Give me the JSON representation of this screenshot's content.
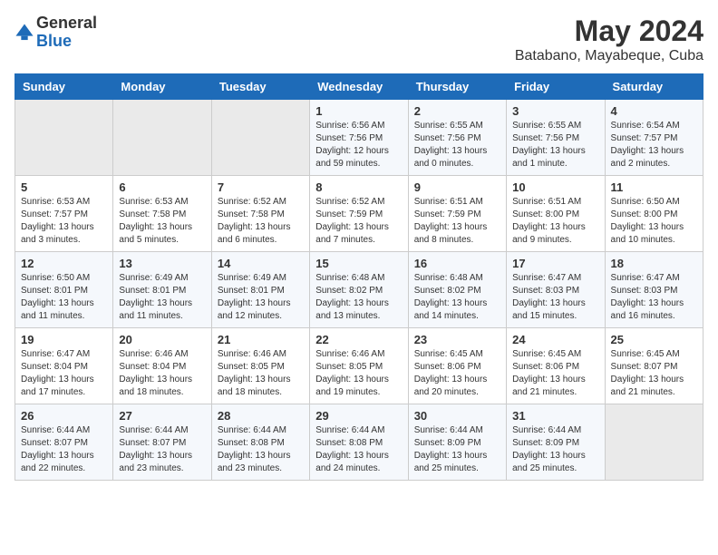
{
  "logo": {
    "general": "General",
    "blue": "Blue"
  },
  "title": "May 2024",
  "subtitle": "Batabano, Mayabeque, Cuba",
  "weekdays": [
    "Sunday",
    "Monday",
    "Tuesday",
    "Wednesday",
    "Thursday",
    "Friday",
    "Saturday"
  ],
  "weeks": [
    [
      {
        "day": "",
        "sunrise": "",
        "sunset": "",
        "daylight": "",
        "empty": true
      },
      {
        "day": "",
        "sunrise": "",
        "sunset": "",
        "daylight": "",
        "empty": true
      },
      {
        "day": "",
        "sunrise": "",
        "sunset": "",
        "daylight": "",
        "empty": true
      },
      {
        "day": "1",
        "sunrise": "Sunrise: 6:56 AM",
        "sunset": "Sunset: 7:56 PM",
        "daylight": "Daylight: 12 hours and 59 minutes."
      },
      {
        "day": "2",
        "sunrise": "Sunrise: 6:55 AM",
        "sunset": "Sunset: 7:56 PM",
        "daylight": "Daylight: 13 hours and 0 minutes."
      },
      {
        "day": "3",
        "sunrise": "Sunrise: 6:55 AM",
        "sunset": "Sunset: 7:56 PM",
        "daylight": "Daylight: 13 hours and 1 minute."
      },
      {
        "day": "4",
        "sunrise": "Sunrise: 6:54 AM",
        "sunset": "Sunset: 7:57 PM",
        "daylight": "Daylight: 13 hours and 2 minutes."
      }
    ],
    [
      {
        "day": "5",
        "sunrise": "Sunrise: 6:53 AM",
        "sunset": "Sunset: 7:57 PM",
        "daylight": "Daylight: 13 hours and 3 minutes."
      },
      {
        "day": "6",
        "sunrise": "Sunrise: 6:53 AM",
        "sunset": "Sunset: 7:58 PM",
        "daylight": "Daylight: 13 hours and 5 minutes."
      },
      {
        "day": "7",
        "sunrise": "Sunrise: 6:52 AM",
        "sunset": "Sunset: 7:58 PM",
        "daylight": "Daylight: 13 hours and 6 minutes."
      },
      {
        "day": "8",
        "sunrise": "Sunrise: 6:52 AM",
        "sunset": "Sunset: 7:59 PM",
        "daylight": "Daylight: 13 hours and 7 minutes."
      },
      {
        "day": "9",
        "sunrise": "Sunrise: 6:51 AM",
        "sunset": "Sunset: 7:59 PM",
        "daylight": "Daylight: 13 hours and 8 minutes."
      },
      {
        "day": "10",
        "sunrise": "Sunrise: 6:51 AM",
        "sunset": "Sunset: 8:00 PM",
        "daylight": "Daylight: 13 hours and 9 minutes."
      },
      {
        "day": "11",
        "sunrise": "Sunrise: 6:50 AM",
        "sunset": "Sunset: 8:00 PM",
        "daylight": "Daylight: 13 hours and 10 minutes."
      }
    ],
    [
      {
        "day": "12",
        "sunrise": "Sunrise: 6:50 AM",
        "sunset": "Sunset: 8:01 PM",
        "daylight": "Daylight: 13 hours and 11 minutes."
      },
      {
        "day": "13",
        "sunrise": "Sunrise: 6:49 AM",
        "sunset": "Sunset: 8:01 PM",
        "daylight": "Daylight: 13 hours and 11 minutes."
      },
      {
        "day": "14",
        "sunrise": "Sunrise: 6:49 AM",
        "sunset": "Sunset: 8:01 PM",
        "daylight": "Daylight: 13 hours and 12 minutes."
      },
      {
        "day": "15",
        "sunrise": "Sunrise: 6:48 AM",
        "sunset": "Sunset: 8:02 PM",
        "daylight": "Daylight: 13 hours and 13 minutes."
      },
      {
        "day": "16",
        "sunrise": "Sunrise: 6:48 AM",
        "sunset": "Sunset: 8:02 PM",
        "daylight": "Daylight: 13 hours and 14 minutes."
      },
      {
        "day": "17",
        "sunrise": "Sunrise: 6:47 AM",
        "sunset": "Sunset: 8:03 PM",
        "daylight": "Daylight: 13 hours and 15 minutes."
      },
      {
        "day": "18",
        "sunrise": "Sunrise: 6:47 AM",
        "sunset": "Sunset: 8:03 PM",
        "daylight": "Daylight: 13 hours and 16 minutes."
      }
    ],
    [
      {
        "day": "19",
        "sunrise": "Sunrise: 6:47 AM",
        "sunset": "Sunset: 8:04 PM",
        "daylight": "Daylight: 13 hours and 17 minutes."
      },
      {
        "day": "20",
        "sunrise": "Sunrise: 6:46 AM",
        "sunset": "Sunset: 8:04 PM",
        "daylight": "Daylight: 13 hours and 18 minutes."
      },
      {
        "day": "21",
        "sunrise": "Sunrise: 6:46 AM",
        "sunset": "Sunset: 8:05 PM",
        "daylight": "Daylight: 13 hours and 18 minutes."
      },
      {
        "day": "22",
        "sunrise": "Sunrise: 6:46 AM",
        "sunset": "Sunset: 8:05 PM",
        "daylight": "Daylight: 13 hours and 19 minutes."
      },
      {
        "day": "23",
        "sunrise": "Sunrise: 6:45 AM",
        "sunset": "Sunset: 8:06 PM",
        "daylight": "Daylight: 13 hours and 20 minutes."
      },
      {
        "day": "24",
        "sunrise": "Sunrise: 6:45 AM",
        "sunset": "Sunset: 8:06 PM",
        "daylight": "Daylight: 13 hours and 21 minutes."
      },
      {
        "day": "25",
        "sunrise": "Sunrise: 6:45 AM",
        "sunset": "Sunset: 8:07 PM",
        "daylight": "Daylight: 13 hours and 21 minutes."
      }
    ],
    [
      {
        "day": "26",
        "sunrise": "Sunrise: 6:44 AM",
        "sunset": "Sunset: 8:07 PM",
        "daylight": "Daylight: 13 hours and 22 minutes."
      },
      {
        "day": "27",
        "sunrise": "Sunrise: 6:44 AM",
        "sunset": "Sunset: 8:07 PM",
        "daylight": "Daylight: 13 hours and 23 minutes."
      },
      {
        "day": "28",
        "sunrise": "Sunrise: 6:44 AM",
        "sunset": "Sunset: 8:08 PM",
        "daylight": "Daylight: 13 hours and 23 minutes."
      },
      {
        "day": "29",
        "sunrise": "Sunrise: 6:44 AM",
        "sunset": "Sunset: 8:08 PM",
        "daylight": "Daylight: 13 hours and 24 minutes."
      },
      {
        "day": "30",
        "sunrise": "Sunrise: 6:44 AM",
        "sunset": "Sunset: 8:09 PM",
        "daylight": "Daylight: 13 hours and 25 minutes."
      },
      {
        "day": "31",
        "sunrise": "Sunrise: 6:44 AM",
        "sunset": "Sunset: 8:09 PM",
        "daylight": "Daylight: 13 hours and 25 minutes."
      },
      {
        "day": "",
        "sunrise": "",
        "sunset": "",
        "daylight": "",
        "empty": true
      }
    ]
  ]
}
